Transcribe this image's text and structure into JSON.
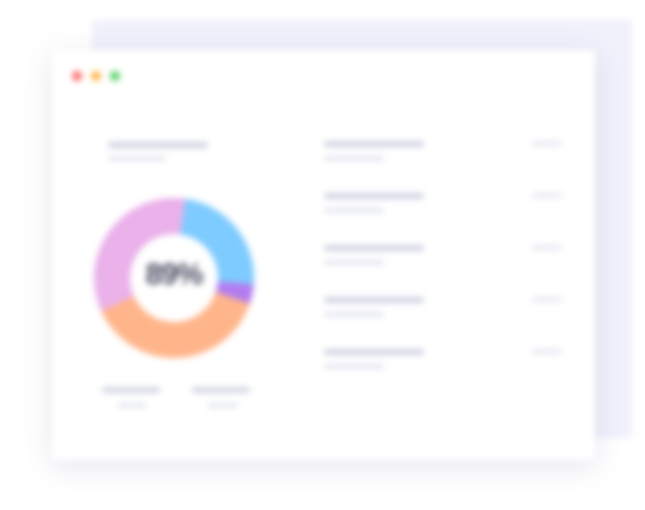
{
  "window": {
    "controls": [
      "close",
      "minimize",
      "maximize"
    ],
    "control_colors": {
      "close": "#ff6b6b",
      "minimize": "#ffb347",
      "maximize": "#5ad167"
    }
  },
  "chart": {
    "center_text": "89%"
  },
  "chart_data": {
    "type": "pie",
    "title": "",
    "values": [
      24,
      4,
      38,
      34
    ],
    "colors": [
      "#7ecbff",
      "#b27cf0",
      "#ffb58a",
      "#eab1ea"
    ]
  },
  "list": {
    "item_count": 5
  }
}
